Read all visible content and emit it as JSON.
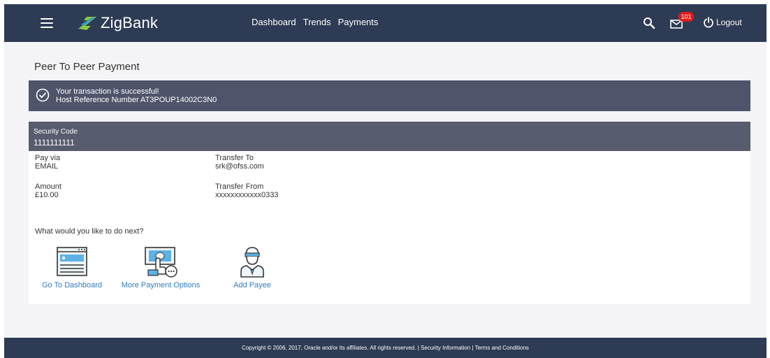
{
  "app": {
    "name": "ZigBank"
  },
  "nav": {
    "items": [
      "Dashboard",
      "Trends",
      "Payments"
    ]
  },
  "header": {
    "mail_count": "101",
    "logout_label": "Logout"
  },
  "page": {
    "title": "Peer To Peer Payment"
  },
  "banner": {
    "message": "Your transaction is successful!",
    "reference": "Host Reference Number AT3POUP14002C3N0"
  },
  "security": {
    "label": "Security Code",
    "value": "1111111111"
  },
  "details": {
    "pay_via_label": "Pay via",
    "pay_via_value": "EMAIL",
    "transfer_to_label": "Transfer To",
    "transfer_to_value": "srk@ofss.com",
    "amount_label": "Amount",
    "amount_value": "£10.00",
    "transfer_from_label": "Transfer From",
    "transfer_from_value": "xxxxxxxxxxxx0333"
  },
  "next": {
    "question": "What would you like to do next?",
    "actions": [
      "Go To Dashboard",
      "More Payment Options",
      "Add Payee"
    ]
  },
  "footer": {
    "copyright": "Copyright © 2006, 2017, Oracle and/or its affiliates. All rights reserved.",
    "separator": "|",
    "security_link": "Security Information",
    "terms_link": "Terms and Conditions"
  },
  "colors": {
    "header": "#2d3b54",
    "banner": "#4f546b",
    "security_bar": "#585c6f",
    "link": "#2f7dc1",
    "badge": "#e01b1b"
  }
}
